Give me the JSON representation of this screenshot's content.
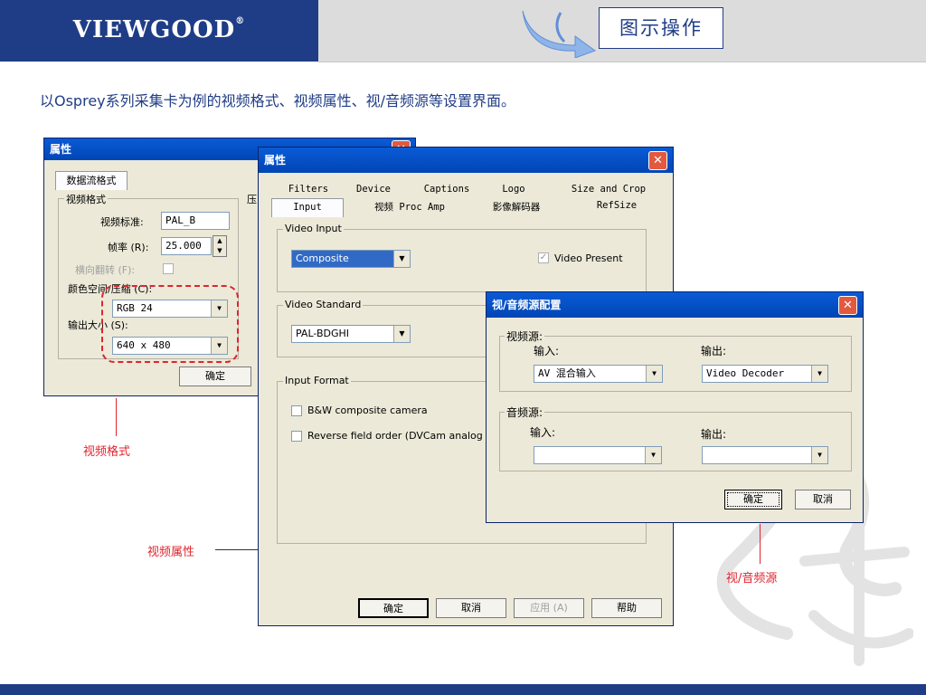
{
  "header": {
    "logo": "VIEWGOOD",
    "logo_mark": "®",
    "title": "图示操作",
    "subtitle": "以Osprey系列采集卡为例的视频格式、视频属性、视/音频源等设置界面。"
  },
  "win1": {
    "title": "属性",
    "tab": "数据流格式",
    "group_label": "视频格式",
    "side_label": "压",
    "video_standard_label": "视频标准:",
    "video_standard_value": "PAL_B",
    "frame_rate_label": "帧率 (R):",
    "frame_rate_value": "25.000",
    "flip_label": "横向翻转 (F):",
    "colorspace_label": "颜色空间/压缩 (C):",
    "colorspace_value": "RGB 24",
    "output_size_label": "输出大小 (S):",
    "output_size_value": "640 x 480",
    "ok_label": "确定"
  },
  "win2": {
    "title": "属性",
    "tabs_row1": [
      "Filters",
      "Device",
      "Captions",
      "Logo",
      "Size and Crop"
    ],
    "tabs_row2": [
      "Input",
      "视频 Proc Amp",
      "影像解码器",
      "RefSize"
    ],
    "video_input_label": "Video Input",
    "video_input_value": "Composite",
    "video_present_label": "Video Present",
    "video_standard_label": "Video Standard",
    "video_standard_value": "PAL-BDGHI",
    "input_format_label": "Input Format",
    "bw_label": "B&W composite camera",
    "reverse_label": "Reverse field order (DVCam analog tra",
    "ok_label": "确定",
    "cancel_label": "取消",
    "apply_label": "应用 (A)",
    "help_label": "帮助"
  },
  "win3": {
    "title": "视/音频源配置",
    "video_source_label": "视频源:",
    "video_input_label": "输入:",
    "video_output_label": "输出:",
    "video_input_value": "AV 混合输入",
    "video_output_value": "Video Decoder",
    "audio_source_label": "音频源:",
    "audio_input_label": "输入:",
    "audio_output_label": "输出:",
    "audio_input_value": "",
    "audio_output_value": "",
    "ok_label": "确定",
    "cancel_label": "取消"
  },
  "annotations": {
    "video_format": "视频格式",
    "video_properties": "视频属性",
    "av_source": "视/音频源"
  },
  "colors": {
    "brand_blue": "#1f3d86",
    "annotation_red": "#e0242e"
  }
}
